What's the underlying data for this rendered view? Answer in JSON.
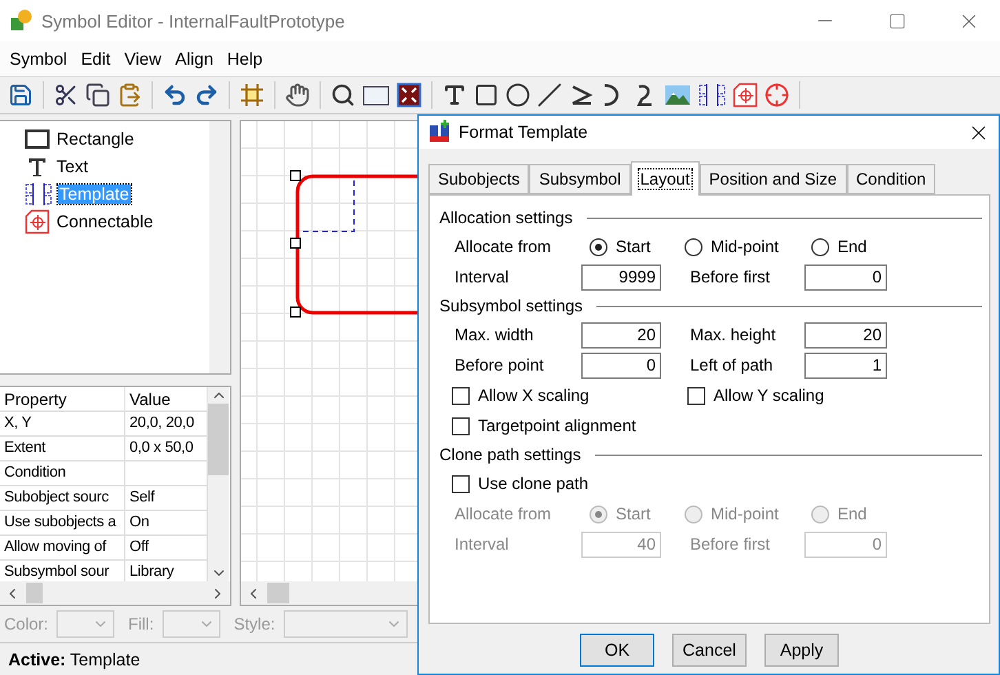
{
  "window": {
    "title": "Symbol Editor - InternalFaultPrototype"
  },
  "menu": [
    "Symbol",
    "Edit",
    "View",
    "Align",
    "Help"
  ],
  "object_tree": [
    {
      "label": "Rectangle",
      "kind": "rectangle",
      "selected": false
    },
    {
      "label": "Text",
      "kind": "text",
      "selected": false
    },
    {
      "label": "Template",
      "kind": "template",
      "selected": true
    },
    {
      "label": "Connectable",
      "kind": "connectable",
      "selected": false
    }
  ],
  "properties": {
    "columns": [
      "Property",
      "Value"
    ],
    "rows": [
      {
        "property": "X, Y",
        "value": "20,0, 20,0"
      },
      {
        "property": "Extent",
        "value": "0,0 x 50,0"
      },
      {
        "property": "Condition"
      },
      {
        "property": "Subobject sourc",
        "value": "Self"
      },
      {
        "property": "Use subobjects a",
        "value": "On"
      },
      {
        "property": "Allow moving of",
        "value": "Off"
      },
      {
        "property": "Subsymbol sour",
        "value": "Library"
      }
    ]
  },
  "style_bar": [
    {
      "label": "Color:",
      "disabled": true
    },
    {
      "label": "Fill:",
      "disabled": true
    },
    {
      "label": "Style:",
      "disabled": true
    }
  ],
  "status_bar": {
    "text": "**Active:** Template"
  },
  "dialog": {
    "title": "Format Template",
    "tabs": [
      {
        "label": "Subobjects",
        "selected": false
      },
      {
        "label": "Subsymbol",
        "selected": false
      },
      {
        "label": "Layout",
        "selected": true
      },
      {
        "label": "Position and Size",
        "selected": false
      },
      {
        "label": "Condition",
        "selected": false
      }
    ],
    "sections": [
      {
        "title": "Allocation settings",
        "rows": [
          {
            "kind": "radio",
            "label": "Allocate from",
            "disabled": false,
            "options": [
              {
                "label": "Start",
                "selected": true
              },
              {
                "label": "Mid-point",
                "selected": false
              },
              {
                "label": "End",
                "selected": false
              }
            ]
          },
          {
            "kind": "fields",
            "disabled": false,
            "fields": [
              {
                "label": "Interval",
                "value": "9999"
              },
              {
                "label": "Before first",
                "value": "0"
              }
            ]
          }
        ]
      },
      {
        "title": "Subsymbol settings",
        "rows": [
          {
            "kind": "fields",
            "disabled": false,
            "fields": [
              {
                "label": "Max. width",
                "value": "20"
              },
              {
                "label": "Max. height",
                "value": "20"
              }
            ]
          },
          {
            "kind": "fields",
            "disabled": false,
            "fields": [
              {
                "label": "Before point",
                "value": "0"
              },
              {
                "label": "Left of path",
                "value": "1"
              }
            ]
          },
          {
            "kind": "checkboxes",
            "items": [
              {
                "label": "Allow X scaling",
                "checked": false
              },
              {
                "label": "Allow Y scaling",
                "checked": false
              }
            ]
          },
          {
            "kind": "checkboxes",
            "items": [
              {
                "label": "Targetpoint alignment",
                "checked": false
              }
            ]
          }
        ]
      },
      {
        "title": "Clone path settings",
        "rows": [
          {
            "kind": "checkboxes",
            "items": [
              {
                "label": "Use clone path",
                "checked": false
              }
            ]
          },
          {
            "kind": "radio",
            "label": "Allocate from",
            "disabled": true,
            "options": [
              {
                "label": "Start",
                "selected": true
              },
              {
                "label": "Mid-point",
                "selected": false
              },
              {
                "label": "End",
                "selected": false
              }
            ]
          },
          {
            "kind": "fields",
            "disabled": true,
            "fields": [
              {
                "label": "Interval",
                "value": "40"
              },
              {
                "label": "Before first",
                "value": "0"
              }
            ]
          }
        ]
      }
    ],
    "buttons": [
      "OK",
      "Cancel",
      "Apply"
    ]
  }
}
